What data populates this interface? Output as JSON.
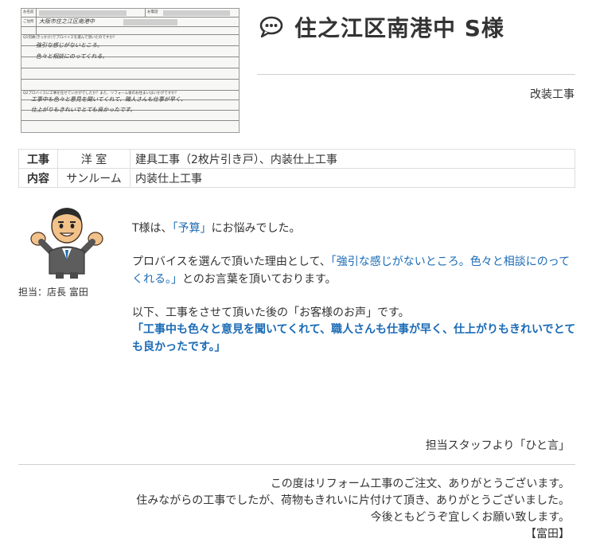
{
  "questionnaire": {
    "name_label": "お名前",
    "tel_label": "お電話",
    "address_label": "ご住所",
    "address_hand": "大阪市住之江区南港中",
    "q1": "Q1何故(きっかけ)でプロバイスを選んで頂いたのですか？",
    "a1_line1": "強引な感じがないところ。",
    "a1_line2": "色々と相談にのってくれる。",
    "q2": "Q2プロバイスに工事を任せていかがでしたか？また、リフォーム後のお住まいはいかがですか？",
    "a2_line1": "工事中も色々と意見を聞いてくれて、職人さんも仕事が早く、",
    "a2_line2": "仕上がりもきれいでとても良かったです。"
  },
  "header": {
    "title": "住之江区南港中 S様",
    "category": "改装工事",
    "icon": "speech-bubble-icon"
  },
  "work": {
    "label_top": "工事",
    "label_bottom": "内容",
    "rows": [
      {
        "room": "洋 室",
        "detail": "建具工事（2枚片引き戸）、内装仕上工事"
      },
      {
        "room": "サンルーム",
        "detail": "内装仕上工事"
      }
    ]
  },
  "staff": {
    "caption": "担当：店長 富田"
  },
  "message": {
    "p1_a": "T様は、",
    "p1_b": "「予算」",
    "p1_c": "にお悩みでした。",
    "p2_a": "プロバイスを選んで頂いた理由として、",
    "p2_b": "「強引な感じがないところ。色々と相談にのってくれる。」",
    "p2_c": "とのお言葉を頂いております。",
    "p3": "以下、工事をさせて頂いた後の「お客様のお声」です。",
    "p4": "「工事中も色々と意見を聞いてくれて、職人さんも仕事が早く、仕上がりもきれいでとても良かったです。」"
  },
  "hitokoto": {
    "label": "担当スタッフより「ひと言」",
    "line1": "この度はリフォーム工事のご注文、ありがとうございます。",
    "line2": "住みながらの工事でしたが、荷物もきれいに片付けて頂き、ありがとうございました。",
    "line3": "今後ともどうぞ宜しくお願い致します。",
    "sign": "【富田】"
  },
  "colors": {
    "accent_blue": "#1b6bb5",
    "text": "#333333",
    "rule": "#cfcfcf"
  }
}
